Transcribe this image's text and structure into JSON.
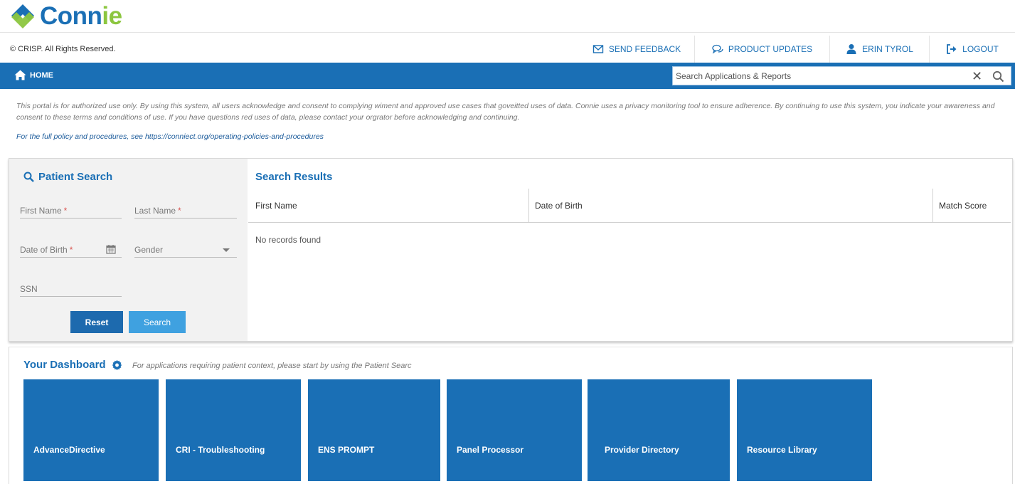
{
  "app": {
    "name": "Connie",
    "name_prefix": "Conn",
    "name_suffix": "ie"
  },
  "utility_bar": {
    "copyright": "© CRISP. All Rights Reserved.",
    "send_feedback": "SEND FEEDBACK",
    "product_updates": "PRODUCT UPDATES",
    "user_name": "ERIN TYROL",
    "logout": "LOGOUT"
  },
  "nav": {
    "home_label": "HOME",
    "search_placeholder": "Search Applications & Reports"
  },
  "notice": {
    "text": "This portal is for authorized use only. By using this system, all users acknowledge and consent to complying wiment and approved use cases that goveitted uses of data. Connie uses a privacy monitoring tool to ensure adherence. By continuing to use this system, you indicate your awareness and consent to these terms and conditions of use. If you have questions red uses of data, please contact your orgrator before acknowledging and continuing.",
    "policy_prefix": "For the full policy and procedures, see ",
    "policy_link": "https://conniect.org/operating-policies-and-procedures"
  },
  "patient_search": {
    "title": "Patient Search",
    "first_name": "First Name",
    "last_name": "Last Name",
    "date_of_birth": "Date of Birth",
    "gender": "Gender",
    "ssn": "SSN",
    "required_mark": "*",
    "reset_button": "Reset",
    "search_button": "Search"
  },
  "search_results": {
    "title": "Search Results",
    "columns": [
      "First Name",
      "Date of Birth",
      "Match Score"
    ],
    "empty_message": "No records found"
  },
  "dashboard": {
    "title": "Your Dashboard",
    "hint": "For applications requiring patient context, please start by using the Patient Searc",
    "tiles": [
      "AdvanceDirective",
      "CRI - Troubleshooting",
      "ENS PROMPT",
      "Panel Processor",
      "Provider Directory",
      "Resource Library"
    ]
  },
  "colors": {
    "primary": "#1a6fb5",
    "secondary_button": "#3fa1e0",
    "logo_green": "#8cc63f",
    "required": "#d9534f"
  },
  "icons": {
    "logo": "connie-logo-icon",
    "send_feedback": "envelope-icon",
    "product_updates": "chat-bubbles-icon",
    "user": "user-icon",
    "logout": "sign-out-icon",
    "home": "home-icon",
    "clear": "close-icon",
    "search": "search-icon",
    "calendar": "calendar-icon",
    "dropdown": "caret-down-icon",
    "settings": "gear-icon"
  }
}
